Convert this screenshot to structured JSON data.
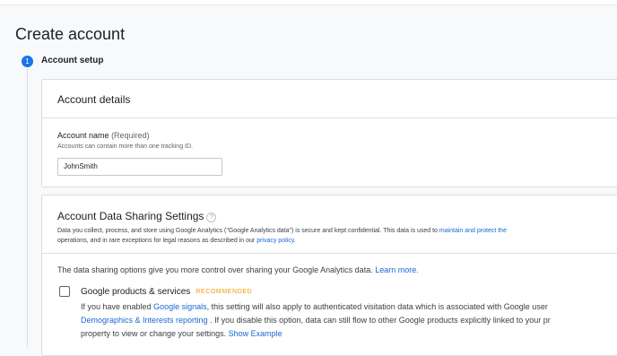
{
  "page": {
    "title": "Create account"
  },
  "step": {
    "number": "1",
    "title": "Account setup"
  },
  "account_details": {
    "heading": "Account details",
    "name_label": "Account name",
    "name_required": "(Required)",
    "name_hint": "Accounts can contain more than one tracking ID.",
    "name_value": "JohnSmith"
  },
  "sharing": {
    "heading": "Account Data Sharing Settings",
    "help_icon": "?",
    "desc_line1_a": "Data you collect, process, and store using Google Analytics (\"Google Analytics data\") is secure and kept confidential. This data is used to ",
    "desc_line1_link": "maintain and protect the",
    "desc_line2_a": "operations, and in rare exceptions for legal reasons as described in our ",
    "desc_line2_link": "privacy policy",
    "desc_line2_b": ".",
    "options_text": "The data sharing options give you more control over sharing your Google Analytics data. ",
    "learn_more": "Learn more.",
    "google_products": {
      "title": "Google products & services",
      "badge": "RECOMMENDED",
      "line1_a": "If you have enabled ",
      "line1_link": "Google signals",
      "line1_b": ", this setting will also apply to authenticated visitation data which is associated with Google user",
      "line2_link": "Demographics & Interests reporting",
      "line2_b": " . If you disable this option, data can still flow to other Google products explicitly linked to your pr",
      "line3_a": "property to view or change your settings. ",
      "line3_link": "Show Example"
    }
  },
  "colors": {
    "accent": "#1a73e8",
    "link": "#1967d2",
    "recommended": "#f29900"
  }
}
